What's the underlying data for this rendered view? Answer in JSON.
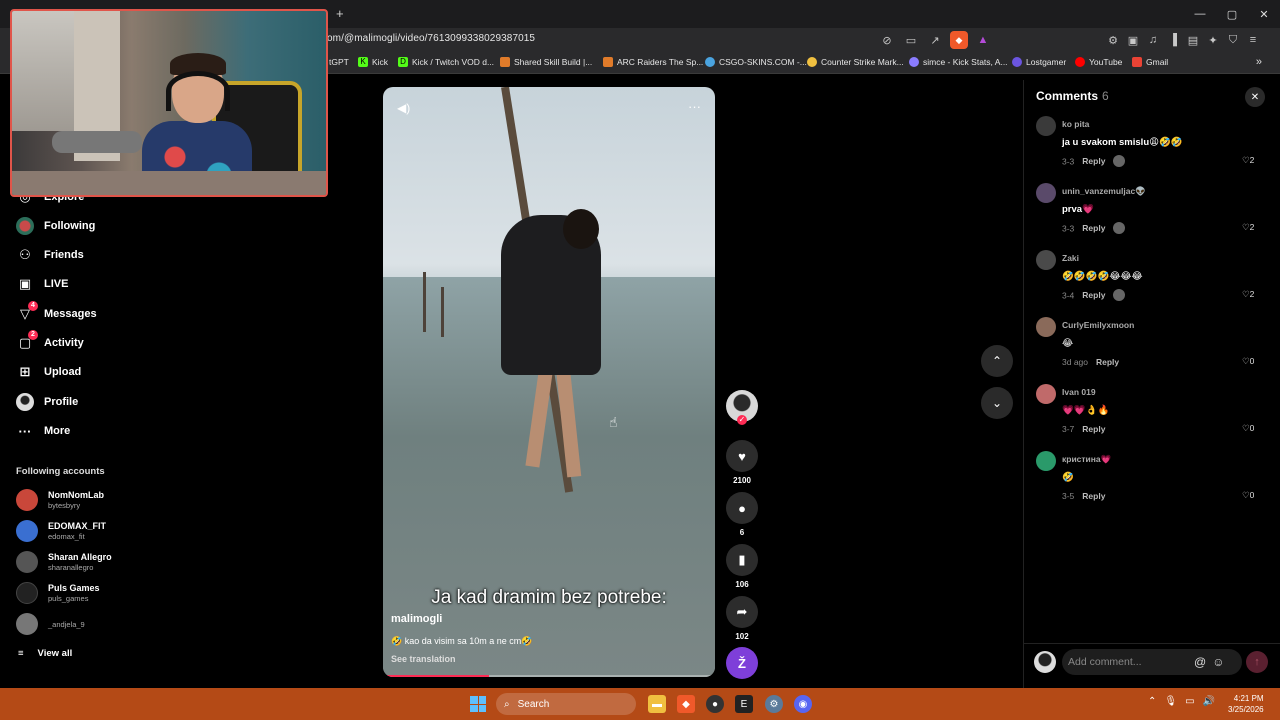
{
  "browser": {
    "new_tab": "+",
    "url": "om/@malimogli/video/7613099338029387015",
    "window_controls": [
      "—",
      "▢",
      "✕"
    ],
    "bookmarks": [
      {
        "label": "tGPT",
        "color": "#2a2a2c"
      },
      {
        "label": "Kick",
        "color": "#53fc18"
      },
      {
        "label": "Kick / Twitch VOD d...",
        "color": "#53fc18"
      },
      {
        "label": "Shared Skill Build |...",
        "color": "#e07b2a"
      },
      {
        "label": "ARC Raiders The Sp...",
        "color": "#e07b2a"
      },
      {
        "label": "CSGO-SKINS.COM -...",
        "color": "#4aa3df"
      },
      {
        "label": "Counter Strike Mark...",
        "color": "#f0c040"
      },
      {
        "label": "simce - Kick Stats, A...",
        "color": "#8a7cff"
      },
      {
        "label": "Lostgamer",
        "color": "#6b55e0"
      },
      {
        "label": "YouTube",
        "color": "#ff0000"
      },
      {
        "label": "Gmail",
        "color": "#ea4335"
      }
    ],
    "bookmarks_more": "»"
  },
  "sidebar": {
    "items": [
      {
        "label": "Explore",
        "icon": "compass-icon"
      },
      {
        "label": "Following",
        "icon": "following-avatar-icon"
      },
      {
        "label": "Friends",
        "icon": "friends-icon"
      },
      {
        "label": "LIVE",
        "icon": "live-icon"
      },
      {
        "label": "Messages",
        "icon": "messages-icon",
        "badge": "4"
      },
      {
        "label": "Activity",
        "icon": "activity-icon",
        "badge": "2"
      },
      {
        "label": "Upload",
        "icon": "upload-icon"
      },
      {
        "label": "Profile",
        "icon": "profile-icon"
      },
      {
        "label": "More",
        "icon": "more-icon"
      }
    ],
    "following_title": "Following accounts",
    "accounts": [
      {
        "name": "NomNomLab",
        "handle": "bytesbyry",
        "color": "#c9473a"
      },
      {
        "name": "EDOMAX_FIT",
        "handle": "edomax_fit",
        "color": "#3a6fd1"
      },
      {
        "name": "Sharan Allegro",
        "handle": "sharanallegro",
        "color": "#555555"
      },
      {
        "name": "Puls Games",
        "handle": "puls_games",
        "color": "#222222"
      },
      {
        "name": "",
        "handle": "_andjela_9",
        "color": "#777777"
      }
    ],
    "view_all": "View all"
  },
  "video": {
    "caption_overlay": "Ja kad dramim bez potrebe:",
    "username": "malimogli",
    "description": "🤣 kao da visim sa 10m a ne cm🤣",
    "see_translation": "See translation",
    "progress": 0.32
  },
  "actions": {
    "likes": "2100",
    "comments": "6",
    "saves": "106",
    "shares": "102",
    "extra_letter": "Ž"
  },
  "comments_panel": {
    "title": "Comments",
    "count": "6",
    "reply_label": "Reply",
    "items": [
      {
        "user": "ko pita",
        "text": "ja u svakom smislu😩🤣🤣",
        "date": "3-3",
        "likes": "2",
        "color": "#3a3a3a"
      },
      {
        "user": "unin_vanzemuljac👽",
        "text": "prva💗",
        "date": "3-3",
        "likes": "2",
        "color": "#5a4a6a"
      },
      {
        "user": "Zaki",
        "text": "🤣🤣🤣🤣😂😂😂",
        "date": "3-4",
        "likes": "2",
        "color": "#4a4a4a"
      },
      {
        "user": "CurlyEmilyxmoon",
        "text": "😂",
        "date": "3d ago",
        "likes": "0",
        "color": "#8a6a5a"
      },
      {
        "user": "Ivan 019",
        "text": "💗💗👌🔥",
        "date": "3-7",
        "likes": "0",
        "color": "#c06a6a"
      },
      {
        "user": "кристина💗",
        "text": "🤣",
        "date": "3-5",
        "likes": "0",
        "color": "#2a9a6a"
      }
    ],
    "add_placeholder": "Add comment..."
  },
  "taskbar": {
    "search": "Search",
    "time": "4:21 PM",
    "date": "3/25/2026",
    "apps": [
      {
        "name": "file-explorer-icon",
        "color": "#f0c040"
      },
      {
        "name": "brave-icon",
        "color": "#f0592a"
      },
      {
        "name": "obs-icon",
        "color": "#333333"
      },
      {
        "name": "epic-games-icon",
        "color": "#222222"
      },
      {
        "name": "settings-icon",
        "color": "#5a7a9a"
      },
      {
        "name": "discord-icon",
        "color": "#5865f2"
      }
    ]
  }
}
